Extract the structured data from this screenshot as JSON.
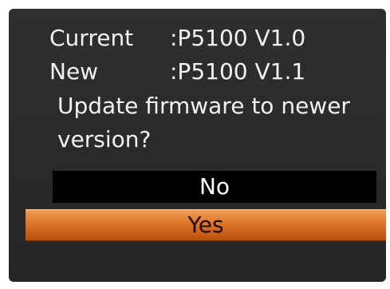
{
  "dialog": {
    "current_label": "Current",
    "current_value": ":P5100 V1.0",
    "new_label": "New",
    "new_value": ":P5100 V1.1",
    "message_line1": "Update firmware to newer",
    "message_line2": "version?",
    "options": [
      {
        "label": "No",
        "selected": false
      },
      {
        "label": "Yes",
        "selected": true
      }
    ]
  },
  "colors": {
    "panel_background": "#2b2b2b",
    "highlight": "#e07a2a",
    "unselected_option": "#000000",
    "text": "#f2f2f2"
  }
}
